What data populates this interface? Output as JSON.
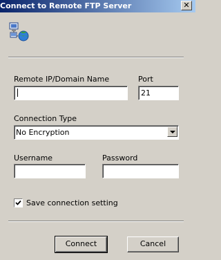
{
  "window": {
    "title": "Connect to Remote FTP Server",
    "close_glyph": "✕"
  },
  "form": {
    "remote_label": "Remote IP/Domain Name",
    "remote_value": "",
    "port_label": "Port",
    "port_value": "21",
    "connection_type_label": "Connection Type",
    "connection_type_value": "No Encryption",
    "username_label": "Username",
    "username_value": "",
    "password_label": "Password",
    "password_value": "",
    "save_setting_label": "Save connection setting",
    "save_setting_checked": true
  },
  "buttons": {
    "connect": "Connect",
    "cancel": "Cancel"
  },
  "icons": {
    "header": "network-computers-globe-icon",
    "dropdown": "chevron-down-icon",
    "checkbox": "checkmark-icon"
  }
}
